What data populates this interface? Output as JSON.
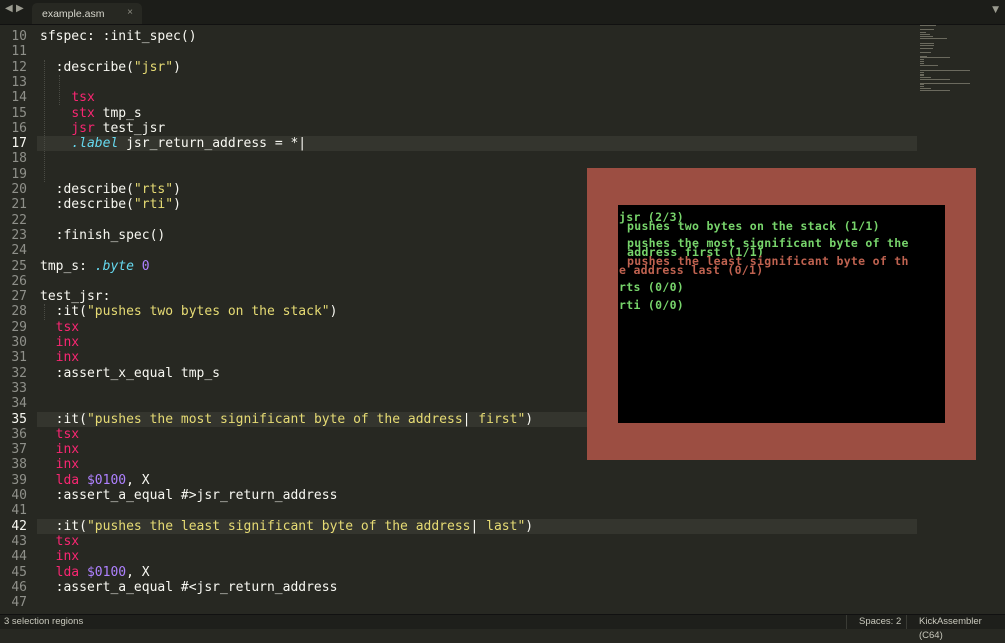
{
  "tabs": [
    {
      "label": "example.asm"
    }
  ],
  "icons": {
    "back": "◀",
    "forward": "▶",
    "close": "×",
    "menu": "▼"
  },
  "colors": {
    "editor_bg": "#272822",
    "keyword": "#f92672",
    "string": "#e6db74",
    "number": "#ae81ff",
    "directive": "#66d9ef",
    "emulator_border": "#9c4e42",
    "test_pass": "#77d46b",
    "test_fail": "#bf6250"
  },
  "editor": {
    "lines": [
      {
        "n": "10",
        "parts": [
          {
            "t": "sfspec: :init_spec()",
            "c": "plain"
          }
        ]
      },
      {
        "n": "11",
        "parts": []
      },
      {
        "n": "12",
        "parts": [
          {
            "t": "  :describe(",
            "c": "plain"
          },
          {
            "t": "\"jsr\"",
            "c": "str"
          },
          {
            "t": ")",
            "c": "plain"
          }
        ]
      },
      {
        "n": "13",
        "parts": []
      },
      {
        "n": "14",
        "parts": [
          {
            "t": "    ",
            "c": "plain"
          },
          {
            "t": "tsx",
            "c": "kw"
          }
        ]
      },
      {
        "n": "15",
        "parts": [
          {
            "t": "    ",
            "c": "plain"
          },
          {
            "t": "stx",
            "c": "kw"
          },
          {
            "t": " tmp_s",
            "c": "plain"
          }
        ]
      },
      {
        "n": "16",
        "parts": [
          {
            "t": "    ",
            "c": "plain"
          },
          {
            "t": "jsr",
            "c": "kw"
          },
          {
            "t": " test_jsr",
            "c": "plain"
          }
        ]
      },
      {
        "n": "17",
        "current": true,
        "parts": [
          {
            "t": "    ",
            "c": "plain"
          },
          {
            "t": ".label",
            "c": "dir"
          },
          {
            "t": " jsr_return_address = *",
            "c": "plain"
          },
          {
            "t": "|",
            "c": "caret"
          }
        ]
      },
      {
        "n": "18",
        "parts": []
      },
      {
        "n": "19",
        "parts": []
      },
      {
        "n": "20",
        "parts": [
          {
            "t": "  :describe(",
            "c": "plain"
          },
          {
            "t": "\"rts\"",
            "c": "str"
          },
          {
            "t": ")",
            "c": "plain"
          }
        ]
      },
      {
        "n": "21",
        "parts": [
          {
            "t": "  :describe(",
            "c": "plain"
          },
          {
            "t": "\"rti\"",
            "c": "str"
          },
          {
            "t": ")",
            "c": "plain"
          }
        ]
      },
      {
        "n": "22",
        "parts": []
      },
      {
        "n": "23",
        "parts": [
          {
            "t": "  :finish_spec()",
            "c": "plain"
          }
        ]
      },
      {
        "n": "24",
        "parts": []
      },
      {
        "n": "25",
        "parts": [
          {
            "t": "tmp_s: ",
            "c": "plain"
          },
          {
            "t": ".byte",
            "c": "dir"
          },
          {
            "t": " ",
            "c": "plain"
          },
          {
            "t": "0",
            "c": "num"
          }
        ]
      },
      {
        "n": "26",
        "parts": []
      },
      {
        "n": "27",
        "parts": [
          {
            "t": "test_jsr:",
            "c": "plain"
          }
        ]
      },
      {
        "n": "28",
        "parts": [
          {
            "t": "  :it(",
            "c": "plain"
          },
          {
            "t": "\"pushes two bytes on the stack\"",
            "c": "str"
          },
          {
            "t": ")",
            "c": "plain"
          }
        ]
      },
      {
        "n": "29",
        "parts": [
          {
            "t": "  ",
            "c": "plain"
          },
          {
            "t": "tsx",
            "c": "kw"
          }
        ]
      },
      {
        "n": "30",
        "parts": [
          {
            "t": "  ",
            "c": "plain"
          },
          {
            "t": "inx",
            "c": "kw"
          }
        ]
      },
      {
        "n": "31",
        "parts": [
          {
            "t": "  ",
            "c": "plain"
          },
          {
            "t": "inx",
            "c": "kw"
          }
        ]
      },
      {
        "n": "32",
        "parts": [
          {
            "t": "  :assert_x_equal tmp_s",
            "c": "plain"
          }
        ]
      },
      {
        "n": "33",
        "parts": []
      },
      {
        "n": "34",
        "parts": []
      },
      {
        "n": "35",
        "current": true,
        "parts": [
          {
            "t": "  :it(",
            "c": "plain"
          },
          {
            "t": "\"pushes the most significant byte of the address",
            "c": "str"
          },
          {
            "t": "|",
            "c": "caret"
          },
          {
            "t": " first\"",
            "c": "str"
          },
          {
            "t": ")",
            "c": "plain"
          }
        ]
      },
      {
        "n": "36",
        "parts": [
          {
            "t": "  ",
            "c": "plain"
          },
          {
            "t": "tsx",
            "c": "kw"
          }
        ]
      },
      {
        "n": "37",
        "parts": [
          {
            "t": "  ",
            "c": "plain"
          },
          {
            "t": "inx",
            "c": "kw"
          }
        ]
      },
      {
        "n": "38",
        "parts": [
          {
            "t": "  ",
            "c": "plain"
          },
          {
            "t": "inx",
            "c": "kw"
          }
        ]
      },
      {
        "n": "39",
        "parts": [
          {
            "t": "  ",
            "c": "plain"
          },
          {
            "t": "lda",
            "c": "kw"
          },
          {
            "t": " ",
            "c": "plain"
          },
          {
            "t": "$0100",
            "c": "num"
          },
          {
            "t": ", X",
            "c": "plain"
          }
        ]
      },
      {
        "n": "40",
        "parts": [
          {
            "t": "  :assert_a_equal #>jsr_return_address",
            "c": "plain"
          }
        ]
      },
      {
        "n": "41",
        "parts": []
      },
      {
        "n": "42",
        "current": true,
        "parts": [
          {
            "t": "  :it(",
            "c": "plain"
          },
          {
            "t": "\"pushes the least significant byte of the address",
            "c": "str"
          },
          {
            "t": "|",
            "c": "caret"
          },
          {
            "t": " last\"",
            "c": "str"
          },
          {
            "t": ")",
            "c": "plain"
          }
        ]
      },
      {
        "n": "43",
        "parts": [
          {
            "t": "  ",
            "c": "plain"
          },
          {
            "t": "tsx",
            "c": "kw"
          }
        ]
      },
      {
        "n": "44",
        "parts": [
          {
            "t": "  ",
            "c": "plain"
          },
          {
            "t": "inx",
            "c": "kw"
          }
        ]
      },
      {
        "n": "45",
        "parts": [
          {
            "t": "  ",
            "c": "plain"
          },
          {
            "t": "lda",
            "c": "kw"
          },
          {
            "t": " ",
            "c": "plain"
          },
          {
            "t": "$0100",
            "c": "num"
          },
          {
            "t": ", X",
            "c": "plain"
          }
        ]
      },
      {
        "n": "46",
        "parts": [
          {
            "t": "  :assert_a_equal #<jsr_return_address",
            "c": "plain"
          }
        ]
      },
      {
        "n": "47",
        "parts": []
      }
    ]
  },
  "emulator": {
    "lines": [
      {
        "text": "jsr (2/3)",
        "status": "ok",
        "indent": 0
      },
      {
        "text": "pushes two bytes on the stack (1/1)",
        "status": "ok",
        "indent": 1
      },
      {
        "text": "",
        "status": "ok",
        "indent": 0
      },
      {
        "text": "pushes the most significant byte of the",
        "status": "ok",
        "indent": 1
      },
      {
        "text": "address first (1/1)",
        "status": "ok",
        "indent": 1
      },
      {
        "text": "pushes the least significant byte of th",
        "status": "fail",
        "indent": 1
      },
      {
        "text": "e address last (0/1)",
        "status": "fail",
        "indent": 0
      },
      {
        "text": "",
        "status": "ok",
        "indent": 0
      },
      {
        "text": "rts (0/0)",
        "status": "ok",
        "indent": 0
      },
      {
        "text": "",
        "status": "ok",
        "indent": 0
      },
      {
        "text": "rti (0/0)",
        "status": "ok",
        "indent": 0
      }
    ]
  },
  "status_bar": {
    "selection": "3 selection regions",
    "indentation": "Spaces: 2",
    "syntax": "KickAssembler (C64)"
  }
}
